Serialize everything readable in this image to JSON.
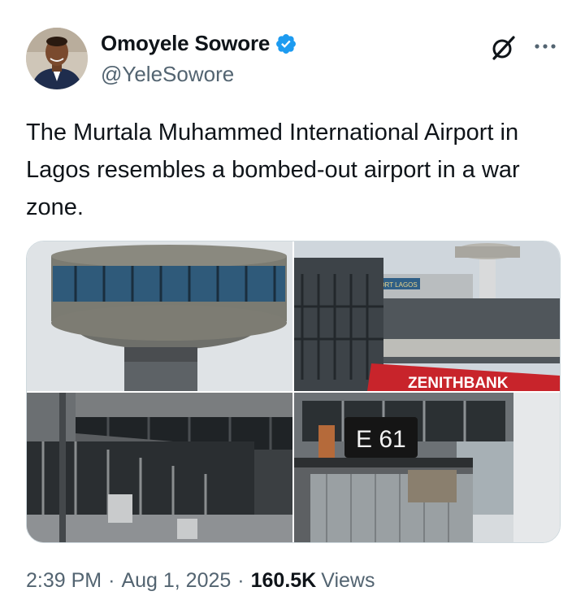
{
  "author": {
    "display_name": "Omoyele Sowore",
    "handle": "@YeleSowore",
    "verified_color": "#1d9bf0"
  },
  "tweet": {
    "text": "The Murtala Muhammed International Airport  in Lagos resembles a bombed-out airport in a war zone."
  },
  "media": {
    "photo2_sign_text": "ZENITHBANK",
    "photo2_building_text": "PORT LAGOS",
    "photo4_sign_text": "E 61"
  },
  "meta": {
    "time": "2:39 PM",
    "separator": "·",
    "date": "Aug 1, 2025",
    "views_count": "160.5K",
    "views_label": "Views"
  },
  "icons": {
    "grok": "grok-icon",
    "more": "more-icon",
    "verified": "verified-badge-icon"
  }
}
